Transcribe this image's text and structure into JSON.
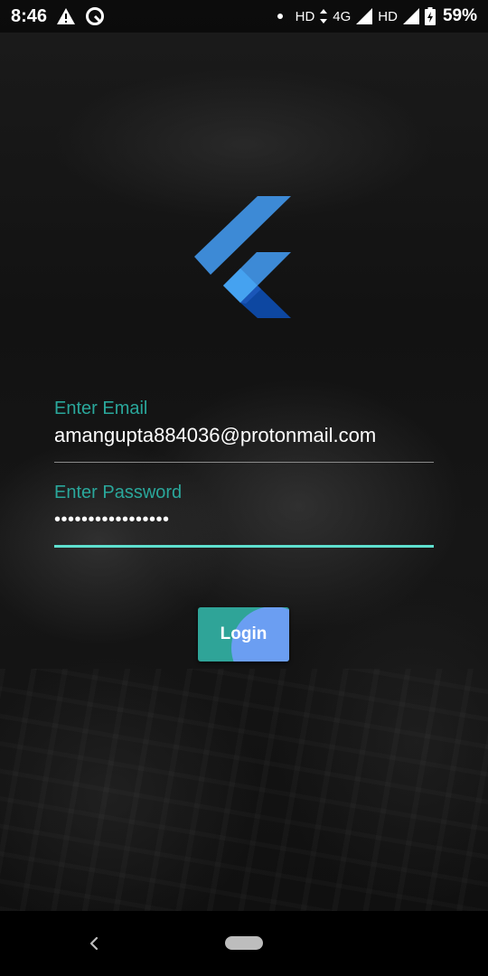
{
  "status_bar": {
    "time": "8:46",
    "icons_left": [
      "warning-icon",
      "data-saver-icon"
    ],
    "network_hd_1": "HD",
    "network_type": "4G",
    "network_hd_2": "HD",
    "battery_percent": "59%"
  },
  "logo": {
    "name": "flutter-logo",
    "colors": [
      "#3d8ad6",
      "#45a2f0",
      "#0d47a1"
    ]
  },
  "form": {
    "email": {
      "label": "Enter Email",
      "value": "amangupta884036@protonmail.com"
    },
    "password": {
      "label": "Enter Password",
      "value": "•••••••••••••••••"
    },
    "login_button": {
      "label": "Login"
    }
  },
  "colors": {
    "accent_label": "#2aa79b",
    "focused_underline": "#5ee0cf",
    "button": "#2fa498",
    "button_ripple": "#6b9ef2"
  },
  "nav_bar": {
    "icons": [
      "back-icon",
      "home-pill-icon"
    ]
  }
}
